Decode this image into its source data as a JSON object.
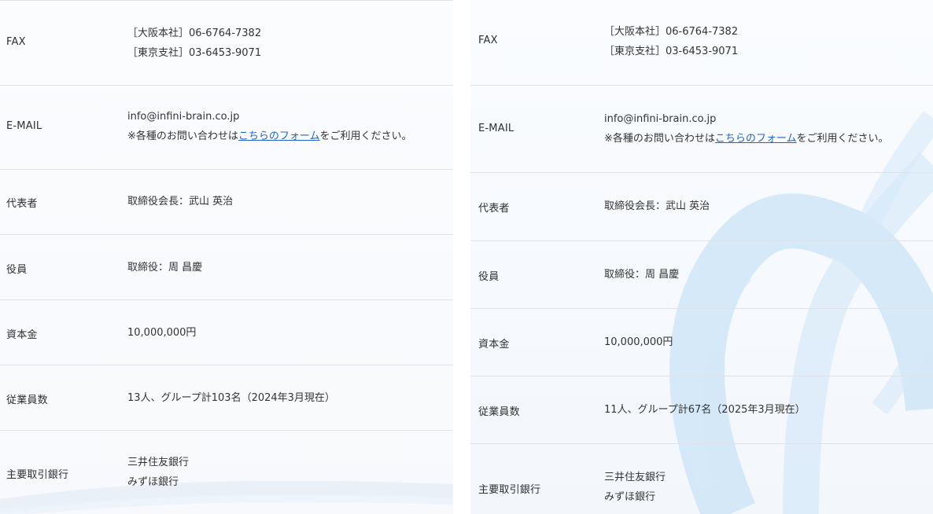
{
  "panels": [
    {
      "rows": [
        {
          "label": "FAX",
          "lines": [
            "［大阪本社］06-6764-7382",
            "［東京支社］03-6453-9071"
          ]
        },
        {
          "label": "E-MAIL",
          "email": "info@infini-brain.co.jp",
          "note_pre": "※各種のお問い合わせは",
          "note_link": "こちらのフォーム",
          "note_post": "をご利用ください。"
        },
        {
          "label": "代表者",
          "value": "取締役会長：武山 英治"
        },
        {
          "label": "役員",
          "value": "取締役：周 昌慶"
        },
        {
          "label": "資本金",
          "value": "10,000,000円"
        },
        {
          "label": "従業員数",
          "value": "13人、グループ計103名（2024年3月現在）"
        },
        {
          "label": "主要取引銀行",
          "lines": [
            "三井住友銀行",
            "みずほ銀行"
          ]
        }
      ]
    },
    {
      "rows": [
        {
          "label": "FAX",
          "lines": [
            "［大阪本社］06-6764-7382",
            "［東京支社］03-6453-9071"
          ]
        },
        {
          "label": "E-MAIL",
          "email": "info@infini-brain.co.jp",
          "note_pre": "※各種のお問い合わせは",
          "note_link": "こちらのフォーム",
          "note_post": "をご利用ください。"
        },
        {
          "label": "代表者",
          "value": "取締役会長：武山 英治"
        },
        {
          "label": "役員",
          "value": "取締役：周 昌慶"
        },
        {
          "label": "資本金",
          "value": "10,000,000円"
        },
        {
          "label": "従業員数",
          "value": "11人、グループ計67名（2025年3月現在）"
        },
        {
          "label": "主要取引銀行",
          "lines": [
            "三井住友銀行",
            "みずほ銀行"
          ]
        }
      ]
    }
  ],
  "colors": {
    "link": "#1f64c7",
    "divider": "#dde2ea",
    "ribbon": "#bcdcf5"
  }
}
